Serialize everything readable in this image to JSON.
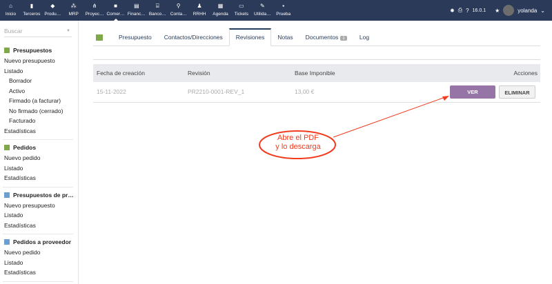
{
  "topbar": {
    "menu": [
      {
        "label": "Inicio",
        "icon": "home-icon",
        "glyph": "⌂"
      },
      {
        "label": "Terceros",
        "icon": "building-icon",
        "glyph": "▮"
      },
      {
        "label": "Produ…",
        "icon": "cube-icon",
        "glyph": "◆"
      },
      {
        "label": "MRP",
        "icon": "cubes-icon",
        "glyph": "⁂"
      },
      {
        "label": "Proyec…",
        "icon": "sitemap-icon",
        "glyph": "⋔"
      },
      {
        "label": "Comer…",
        "icon": "briefcase-icon",
        "glyph": "■"
      },
      {
        "label": "Financ…",
        "icon": "money-icon",
        "glyph": "▤"
      },
      {
        "label": "Banco…",
        "icon": "bank-icon",
        "glyph": "⌸"
      },
      {
        "label": "Conta…",
        "icon": "search-dollar-icon",
        "glyph": "⚲"
      },
      {
        "label": "RRHH",
        "icon": "user-tie-icon",
        "glyph": "♟"
      },
      {
        "label": "Agenda",
        "icon": "calendar-icon",
        "glyph": "▦"
      },
      {
        "label": "Tickets",
        "icon": "ticket-icon",
        "glyph": "▭"
      },
      {
        "label": "Utilida…",
        "icon": "wrench-icon",
        "glyph": "✎"
      },
      {
        "label": "Prueba",
        "icon": "note-icon",
        "glyph": "▪"
      }
    ],
    "version": "16.0.1",
    "user": "yolanda"
  },
  "sidebar": {
    "search_placeholder": "Buscar",
    "blocks": [
      {
        "title": "Presupuestos",
        "color": "#7fa84a",
        "items": [
          {
            "label": "Nuevo presupuesto"
          },
          {
            "label": "Listado"
          },
          {
            "label": "Borrador",
            "sub": true
          },
          {
            "label": "Activo",
            "sub": true
          },
          {
            "label": "Firmado (a facturar)",
            "sub": true
          },
          {
            "label": "No firmado (cerrado)",
            "sub": true
          },
          {
            "label": "Facturado",
            "sub": true
          },
          {
            "label": "Estadísticas"
          }
        ]
      },
      {
        "title": "Pedidos",
        "color": "#7fa84a",
        "items": [
          {
            "label": "Nuevo pedido"
          },
          {
            "label": "Listado"
          },
          {
            "label": "Estadísticas"
          }
        ]
      },
      {
        "title": "Presupuestos de pr…",
        "color": "#6a9fd0",
        "items": [
          {
            "label": "Nuevo presupuesto"
          },
          {
            "label": "Listado"
          },
          {
            "label": "Estadísticas"
          }
        ]
      },
      {
        "title": "Pedidos a proveedor",
        "color": "#6a9fd0",
        "items": [
          {
            "label": "Nuevo pedido"
          },
          {
            "label": "Listado"
          },
          {
            "label": "Estadísticas"
          }
        ]
      }
    ]
  },
  "tabs": [
    {
      "label": "Presupuesto"
    },
    {
      "label": "Contactos/Direcciones"
    },
    {
      "label": "Revisiones",
      "active": true
    },
    {
      "label": "Notas"
    },
    {
      "label": "Documentos",
      "badge": "1"
    },
    {
      "label": "Log"
    }
  ],
  "table": {
    "headers": [
      "Fecha de creación",
      "Revisión",
      "Base Imponible",
      "Acciones"
    ],
    "rows": [
      {
        "date": "15-11-2022",
        "revision": "PR2210-0001-REV_1",
        "base": "13,00 €",
        "view": "VER",
        "delete": "ELIMINAR"
      }
    ]
  },
  "annotation": {
    "line1": "Abre el PDF",
    "line2": "y lo descarga",
    "color": "#f33a1c"
  }
}
